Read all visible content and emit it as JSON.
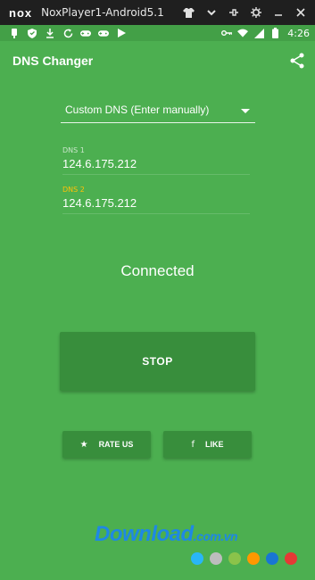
{
  "window": {
    "logo": "nox",
    "title": "NoxPlayer1-Android5.1",
    "controls": [
      "shirt-icon",
      "chevron-down-icon",
      "pin-icon",
      "gear-icon",
      "minimize-icon",
      "close-icon"
    ]
  },
  "status_bar": {
    "time": "4:26",
    "left_icons": [
      "notification-icon",
      "shield-icon",
      "download-icon",
      "sync-icon",
      "gamepad-icon",
      "gamepad-icon",
      "play-store-icon"
    ],
    "right_icons": [
      "key-icon",
      "wifi-icon",
      "signal-icon",
      "battery-icon"
    ]
  },
  "toolbar": {
    "title": "DNS Changer",
    "share_icon": "share-icon"
  },
  "dns_select": {
    "value": "Custom DNS (Enter manually)"
  },
  "dns1": {
    "label": "DNS 1",
    "value": "124.6.175.212"
  },
  "dns2": {
    "label": "DNS 2",
    "value": "124.6.175.212"
  },
  "status": {
    "text": "Connected"
  },
  "buttons": {
    "stop": "STOP",
    "rate": "RATE US",
    "like": "LIKE",
    "rate_icon": "★",
    "like_icon": "f"
  },
  "watermark": {
    "brand": "Download",
    "domain": ".com.vn",
    "dot_colors": [
      "#29b6f6",
      "#bdbdbd",
      "#8bc34a",
      "#ff9800",
      "#1976d2",
      "#e53935"
    ]
  },
  "colors": {
    "primary": "#4caf50",
    "primary_dark": "#388e3c",
    "accent": "#ffc107"
  }
}
